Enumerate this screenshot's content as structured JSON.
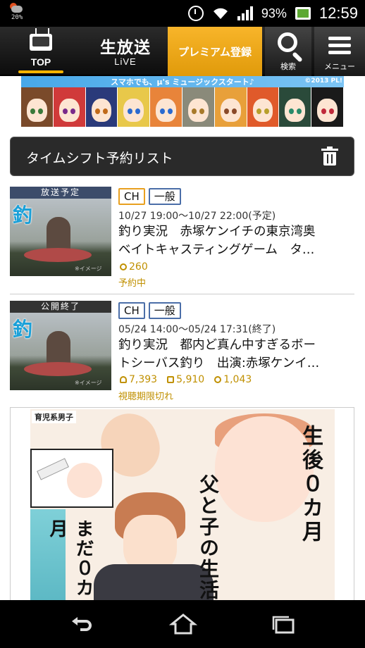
{
  "status_bar": {
    "weather_percent": "20%",
    "battery_percent": "93%",
    "time": "12:59"
  },
  "header": {
    "top_label": "TOP",
    "live_title": "生放送",
    "live_sub": "LiVE",
    "premium_label": "プレミアム登録",
    "search_label": "検索",
    "menu_label": "メニュー"
  },
  "banner": {
    "text": "スマホでも、μ's ミュージックスタート♪",
    "copyright": "©2013 PL!",
    "faces": [
      {
        "hair": "#7a4a2a",
        "eye": "#3a7a3a"
      },
      {
        "hair": "#d03a3a",
        "eye": "#7a2a8a"
      },
      {
        "hair": "#2a3a7a",
        "eye": "#c06a1a"
      },
      {
        "hair": "#e8c84a",
        "eye": "#2a6ad0"
      },
      {
        "hair": "#e8843a",
        "eye": "#2a6ad0"
      },
      {
        "hair": "#8a8a7a",
        "eye": "#a87a2a"
      },
      {
        "hair": "#e8a03a",
        "eye": "#8a4a2a"
      },
      {
        "hair": "#e05a2a",
        "eye": "#b8a02a"
      },
      {
        "hair": "#2a4a3a",
        "eye": "#2a8a6a"
      },
      {
        "hair": "#1a1a1a",
        "eye": "#c02a3a"
      }
    ]
  },
  "timeshift": {
    "title": "タイムシフト予約リスト",
    "items": [
      {
        "thumb_label": "放送予定",
        "channel_tag": "CH",
        "category_tag": "一般",
        "time": "10/27 19:00〜10/27 22:00(予定)",
        "title_line1": "釣り実況　赤塚ケンイチの東京湾奥",
        "title_line2": "ベイトキャスティングゲーム　タ…",
        "points": "260",
        "status": "予約中",
        "image_logo": "釣",
        "image_caption": "※イメージ"
      },
      {
        "thumb_label": "公開終了",
        "channel_tag": "CH",
        "category_tag": "一般",
        "time": "05/24 14:00〜05/24 17:31(終了)",
        "title_line1": "釣り実況　都内ど真ん中すぎるボー",
        "title_line2": "トシーバス釣り　出演:赤塚ケンイ…",
        "viewers": "7,393",
        "comments": "5,910",
        "points": "1,043",
        "status": "視聴期限切れ",
        "image_logo": "釣",
        "image_caption": "※イメージ"
      }
    ]
  },
  "ad": {
    "tag": "育児系男子",
    "text1": "生後０カ月",
    "text2": "父と子の生活",
    "text3": "まだ０カ月"
  }
}
